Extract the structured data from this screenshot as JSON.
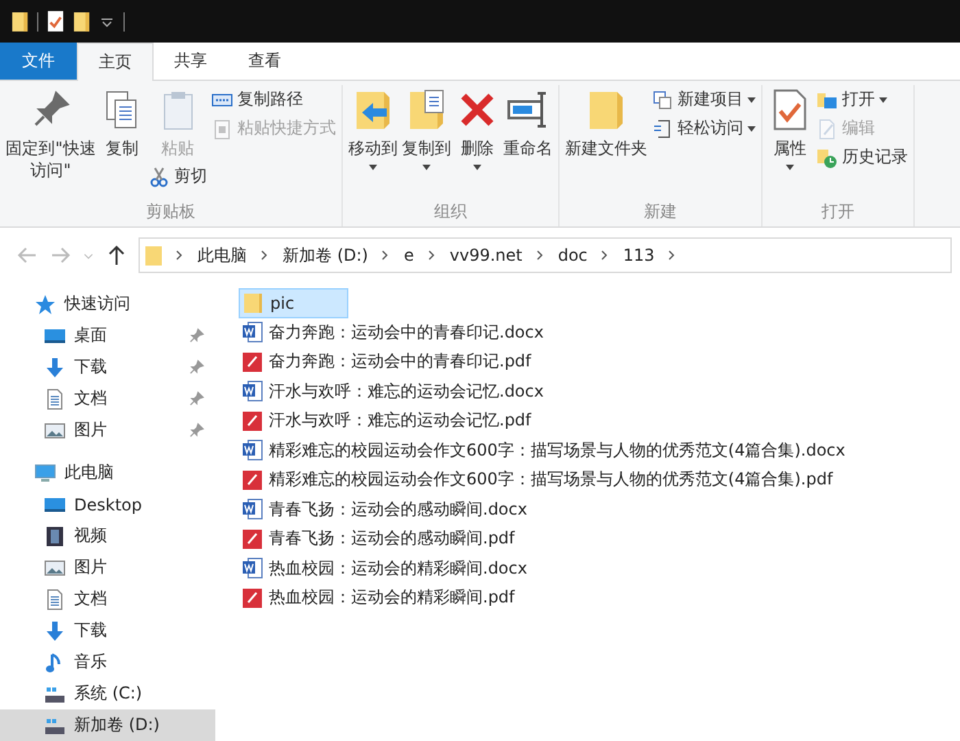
{
  "ribbon_tabs": [
    {
      "label": "文件",
      "kind": "file",
      "selected": false
    },
    {
      "label": "主页",
      "kind": "tab",
      "selected": true
    },
    {
      "label": "共享",
      "kind": "tab",
      "selected": false
    },
    {
      "label": "查看",
      "kind": "tab",
      "selected": false
    }
  ],
  "ribbon_groups": [
    {
      "label": "剪贴板",
      "columns": [
        [
          {
            "label": "固定到\"快速访问\"",
            "kind": "large",
            "disabled": false,
            "dropdown": false
          }
        ],
        [
          {
            "label": "复制",
            "kind": "large",
            "disabled": false,
            "dropdown": false
          }
        ],
        [
          {
            "label": "粘贴",
            "kind": "large",
            "disabled": true,
            "dropdown": false
          },
          {
            "label": "剪切",
            "kind": "small",
            "disabled": false,
            "dropdown": false
          }
        ],
        [
          {
            "label": "复制路径",
            "kind": "small",
            "disabled": false,
            "dropdown": false
          },
          {
            "label": "粘贴快捷方式",
            "kind": "small",
            "disabled": true,
            "dropdown": false
          }
        ]
      ]
    },
    {
      "label": "组织",
      "columns": [
        [
          {
            "label": "移动到",
            "kind": "large",
            "disabled": false,
            "dropdown": true
          }
        ],
        [
          {
            "label": "复制到",
            "kind": "large",
            "disabled": false,
            "dropdown": true
          }
        ],
        [
          {
            "label": "删除",
            "kind": "large",
            "disabled": false,
            "dropdown": true
          }
        ],
        [
          {
            "label": "重命名",
            "kind": "large",
            "disabled": false,
            "dropdown": false
          }
        ]
      ]
    },
    {
      "label": "新建",
      "columns": [
        [
          {
            "label": "新建文件夹",
            "kind": "large",
            "disabled": false,
            "dropdown": false
          }
        ],
        [
          {
            "label": "新建项目",
            "kind": "small",
            "disabled": false,
            "dropdown": true
          },
          {
            "label": "轻松访问",
            "kind": "small",
            "disabled": false,
            "dropdown": true
          }
        ]
      ]
    },
    {
      "label": "打开",
      "columns": [
        [
          {
            "label": "属性",
            "kind": "large",
            "disabled": false,
            "dropdown": true
          }
        ],
        [
          {
            "label": "打开",
            "kind": "small",
            "disabled": false,
            "dropdown": true
          },
          {
            "label": "编辑",
            "kind": "small",
            "disabled": true,
            "dropdown": false
          },
          {
            "label": "历史记录",
            "kind": "small",
            "disabled": false,
            "dropdown": false
          }
        ]
      ]
    }
  ],
  "nav_buttons": [
    {
      "disabled": true
    },
    {
      "disabled": true
    },
    {
      "disabled": true
    },
    {
      "disabled": false
    }
  ],
  "breadcrumb": [
    "此电脑",
    "新加卷 (D:)",
    "e",
    "vv99.net",
    "doc",
    "113"
  ],
  "sidebar": [
    {
      "label": "快速访问",
      "selected": false,
      "children": [
        {
          "label": "桌面",
          "pinned": true,
          "selected": false
        },
        {
          "label": "下载",
          "pinned": true,
          "selected": false
        },
        {
          "label": "文档",
          "pinned": true,
          "selected": false
        },
        {
          "label": "图片",
          "pinned": true,
          "selected": false
        }
      ]
    },
    {
      "label": "此电脑",
      "selected": false,
      "children": [
        {
          "label": "Desktop",
          "pinned": false,
          "selected": false
        },
        {
          "label": "视频",
          "pinned": false,
          "selected": false
        },
        {
          "label": "图片",
          "pinned": false,
          "selected": false
        },
        {
          "label": "文档",
          "pinned": false,
          "selected": false
        },
        {
          "label": "下载",
          "pinned": false,
          "selected": false
        },
        {
          "label": "音乐",
          "pinned": false,
          "selected": false
        },
        {
          "label": "系统 (C:)",
          "pinned": false,
          "selected": false
        },
        {
          "label": "新加卷 (D:)",
          "pinned": false,
          "selected": true
        }
      ]
    }
  ],
  "files": [
    {
      "name": "pic",
      "kind": "folder",
      "selected": true
    },
    {
      "name": "奋力奔跑：运动会中的青春印记.docx",
      "kind": "docx",
      "selected": false
    },
    {
      "name": "奋力奔跑：运动会中的青春印记.pdf",
      "kind": "pdf",
      "selected": false
    },
    {
      "name": "汗水与欢呼：难忘的运动会记忆.docx",
      "kind": "docx",
      "selected": false
    },
    {
      "name": "汗水与欢呼：难忘的运动会记忆.pdf",
      "kind": "pdf",
      "selected": false
    },
    {
      "name": "精彩难忘的校园运动会作文600字：描写场景与人物的优秀范文(4篇合集).docx",
      "kind": "docx",
      "selected": false
    },
    {
      "name": "精彩难忘的校园运动会作文600字：描写场景与人物的优秀范文(4篇合集).pdf",
      "kind": "pdf",
      "selected": false
    },
    {
      "name": "青春飞扬：运动会的感动瞬间.docx",
      "kind": "docx",
      "selected": false
    },
    {
      "name": "青春飞扬：运动会的感动瞬间.pdf",
      "kind": "pdf",
      "selected": false
    },
    {
      "name": "热血校园：运动会的精彩瞬间.docx",
      "kind": "docx",
      "selected": false
    },
    {
      "name": "热血校园：运动会的精彩瞬间.pdf",
      "kind": "pdf",
      "selected": false
    }
  ]
}
